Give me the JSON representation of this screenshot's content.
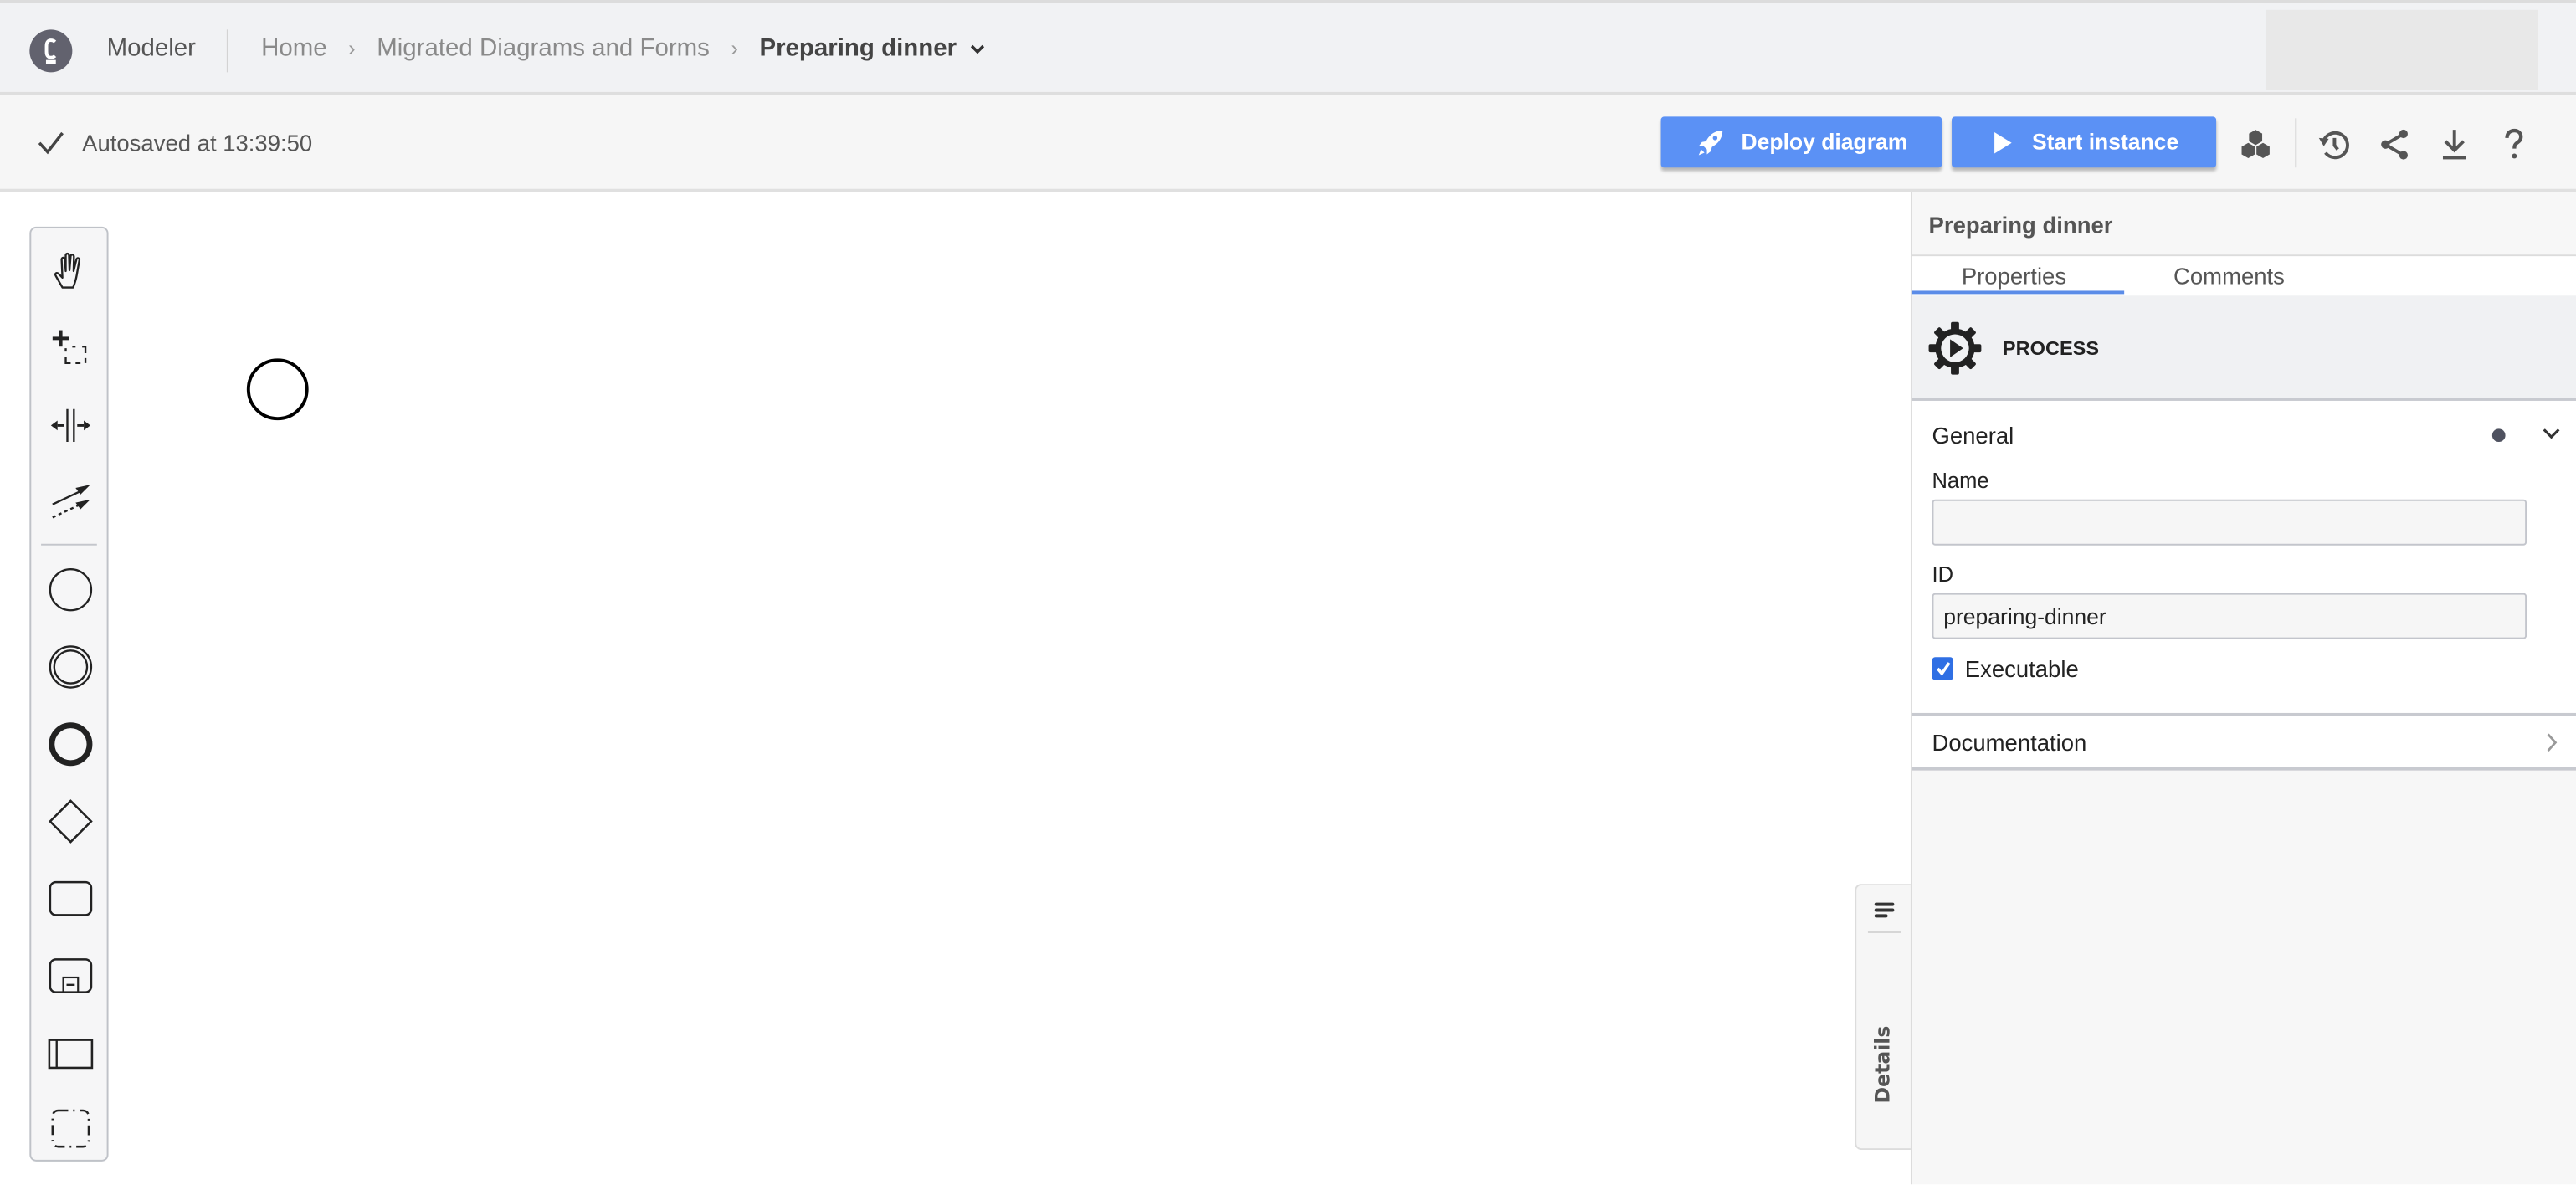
{
  "header": {
    "app_name": "Modeler",
    "breadcrumbs": [
      {
        "label": "Home"
      },
      {
        "label": "Migrated Diagrams and Forms"
      }
    ],
    "current": "Preparing dinner",
    "separator": "›"
  },
  "toolbar": {
    "autosave": "Autosaved at 13:39:50",
    "deploy_label": "Deploy diagram",
    "start_label": "Start instance",
    "icons": [
      "hexagons-icon",
      "history-icon",
      "share-icon",
      "download-icon",
      "help-icon"
    ],
    "accent_color": "#5b91f5"
  },
  "palette": {
    "tools": [
      "hand-tool",
      "lasso-tool",
      "space-tool",
      "global-connect-tool",
      "create-start-event",
      "create-intermediate-event",
      "create-end-event",
      "create-gateway",
      "create-task",
      "create-subprocess",
      "create-pool",
      "create-group"
    ]
  },
  "details_tab": {
    "label": "Details"
  },
  "panel": {
    "title": "Preparing dinner",
    "tabs": [
      {
        "label": "Properties",
        "active": true
      },
      {
        "label": "Comments",
        "active": false
      }
    ],
    "element_type": "PROCESS",
    "groups": {
      "general": {
        "title": "General",
        "name_label": "Name",
        "name_value": "",
        "id_label": "ID",
        "id_value": "preparing-dinner",
        "executable_label": "Executable",
        "executable_checked": true
      },
      "documentation": {
        "title": "Documentation"
      }
    }
  }
}
